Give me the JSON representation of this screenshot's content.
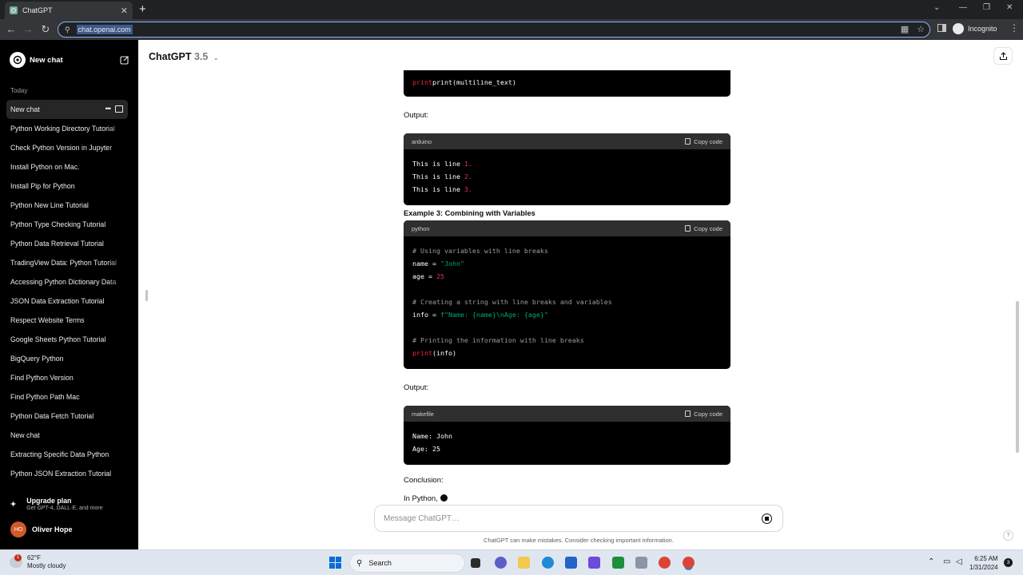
{
  "browser": {
    "tab_title": "ChatGPT",
    "url": "chat.openai.com",
    "profile_label": "Incognito"
  },
  "sidebar": {
    "new_chat_label": "New chat",
    "section_today": "Today",
    "history": [
      {
        "label": "New chat",
        "active": true
      },
      {
        "label": "Python Working Directory Tutorial"
      },
      {
        "label": "Check Python Version in Jupyter"
      },
      {
        "label": "Install Python on Mac."
      },
      {
        "label": "Install Pip for Python"
      },
      {
        "label": "Python New Line Tutorial"
      },
      {
        "label": "Python Type Checking Tutorial"
      },
      {
        "label": "Python Data Retrieval Tutorial"
      },
      {
        "label": "TradingView Data: Python Tutorial"
      },
      {
        "label": "Accessing Python Dictionary Data"
      },
      {
        "label": "JSON Data Extraction Tutorial"
      },
      {
        "label": "Respect Website Terms"
      },
      {
        "label": "Google Sheets Python Tutorial"
      },
      {
        "label": "BigQuery Python"
      },
      {
        "label": "Find Python Version"
      },
      {
        "label": "Find Python Path Mac"
      },
      {
        "label": "Python Data Fetch Tutorial"
      },
      {
        "label": "New chat"
      },
      {
        "label": "Extracting Specific Data Python"
      },
      {
        "label": "Python JSON Extraction Tutorial"
      }
    ],
    "upgrade_title": "Upgrade plan",
    "upgrade_sub": "Get GPT-4, DALL·E, and more",
    "user_initials": "HO",
    "user_name": "Oliver Hope"
  },
  "header": {
    "model_name": "ChatGPT",
    "model_version": "3.5"
  },
  "content": {
    "top_code_line": "print(multiline_text)",
    "output_label_1": "Output:",
    "block_arduino": {
      "lang": "arduino",
      "copy": "Copy code",
      "line_prefix": "This is line ",
      "nums": [
        "1.",
        "2.",
        "3."
      ]
    },
    "example3_title": "Example 3: Combining with Variables",
    "block_python": {
      "lang": "python",
      "copy": "Copy code",
      "comment1": "# Using variables with line breaks",
      "name_lhs": "name = ",
      "name_val": "\"John\"",
      "age_lhs": "age = ",
      "age_val": "25",
      "comment2": "# Creating a string with line breaks and variables",
      "info_lhs": "info = ",
      "info_val": "f\"Name: {name}\\nAge: {age}\"",
      "comment3": "# Printing the information with line breaks",
      "print_fn": "print",
      "print_arg": "(info)"
    },
    "output_label_2": "Output:",
    "block_makefile": {
      "lang": "makefile",
      "copy": "Copy code",
      "line1": "Name: John",
      "line2": "Age: 25"
    },
    "conclusion_label": "Conclusion:",
    "streaming_text": "In Python,"
  },
  "composer": {
    "placeholder": "Message ChatGPT…",
    "disclaimer": "ChatGPT can make mistakes. Consider checking important information."
  },
  "taskbar": {
    "temp": "62°F",
    "condition": "Mostly cloudy",
    "weather_badge": "1",
    "search_label": "Search",
    "time": "6:25 AM",
    "date": "1/31/2024",
    "notif_count": "3"
  }
}
